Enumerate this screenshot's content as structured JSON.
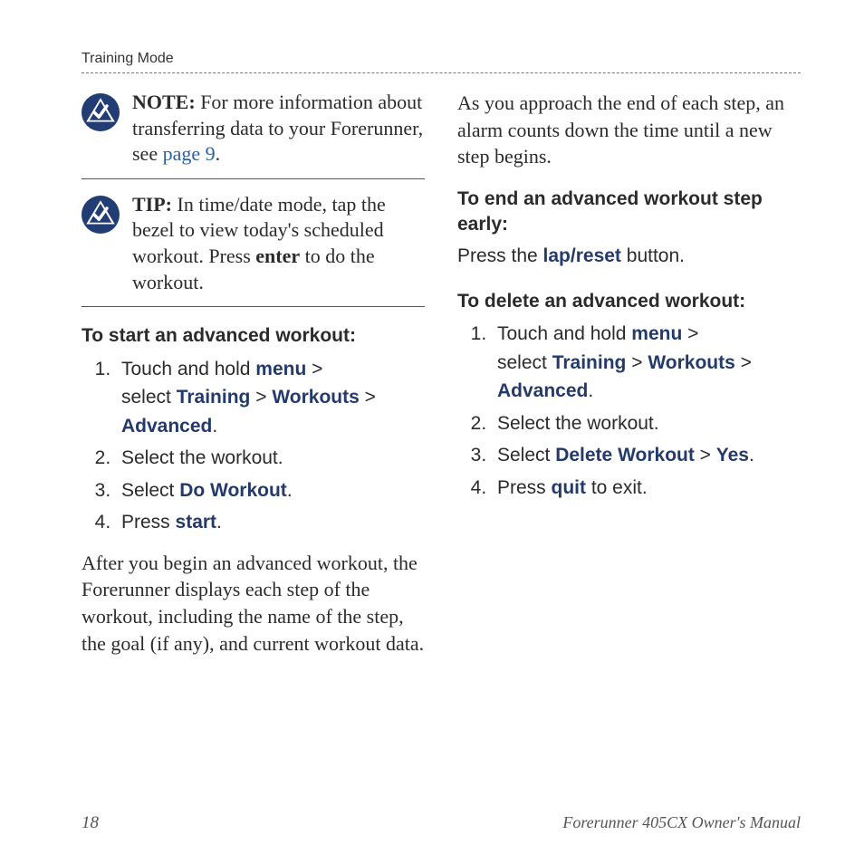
{
  "header": {
    "section": "Training Mode"
  },
  "note": {
    "label": "NOTE:",
    "text_before_link": "For more information about transferring data to your Forerunner, see ",
    "link_text": "page 9",
    "after": "."
  },
  "tip": {
    "label": "TIP:",
    "text_before_enter": "In time/date mode, tap the bezel to view today's scheduled workout. Press ",
    "enter": "enter",
    "after_enter": " to do the workout."
  },
  "start": {
    "title": "To start an advanced workout:",
    "step1_before": "Touch and hold ",
    "menu": "menu",
    "gt": " > ",
    "select_label": "select ",
    "training": "Training",
    "workouts": "Workouts",
    "advanced": "Advanced",
    "dot": ".",
    "step2": "Select the workout.",
    "step3_before": "Select ",
    "do_workout": "Do Workout",
    "step4_before": "Press ",
    "start_word": "start"
  },
  "after_para": "After you begin an advanced workout, the Forerunner displays each step of the workout, including the name of the step, the goal (if any), and current workout data.",
  "right_intro": "As you approach the end of each step, an alarm counts down the time until a new step begins.",
  "end_step": {
    "title": "To end an advanced workout step early:",
    "before": "Press the ",
    "lap_reset": "lap/reset",
    "after": " button."
  },
  "delete": {
    "title": "To delete an advanced workout:",
    "step1_before": "Touch and hold ",
    "step2": "Select the workout.",
    "step3_before": "Select ",
    "delete_workout": "Delete Workout",
    "yes": "Yes",
    "step4_before": "Press ",
    "quit": "quit",
    "step4_after": " to exit."
  },
  "footer": {
    "page": "18",
    "title": "Forerunner 405CX Owner's Manual"
  }
}
